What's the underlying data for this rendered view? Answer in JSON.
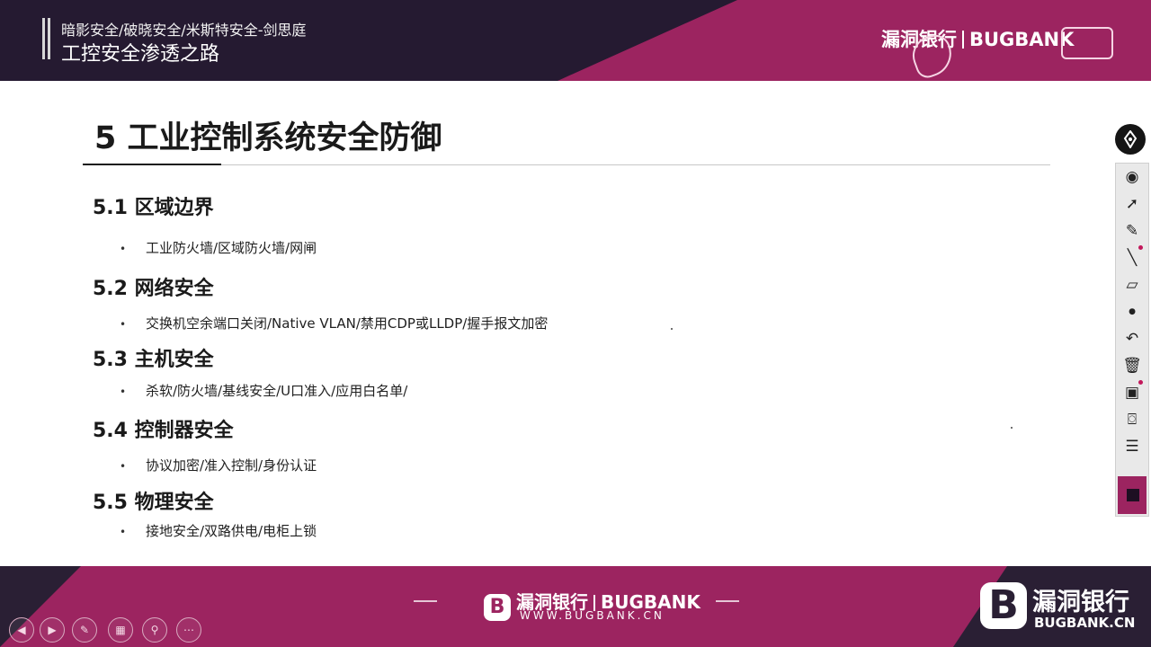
{
  "header": {
    "subtitle": "暗影安全/破晓安全/米斯特安全-剑思庭",
    "title": "工控安全渗透之路",
    "brand_cn": "漏洞银行",
    "brand_en": "BUGBANK"
  },
  "slide": {
    "title": "5 工业控制系统安全防御",
    "sections": [
      {
        "heading": "5.1 区域边界",
        "item": "工业防火墙/区域防火墙/网闸"
      },
      {
        "heading": "5.2 网络安全",
        "item": "交换机空余端口关闭/Native VLAN/禁用CDP或LLDP/握手报文加密"
      },
      {
        "heading": "5.3 主机安全",
        "item": "杀软/防火墙/基线安全/U口准入/应用白名单/"
      },
      {
        "heading": "5.4 控制器安全",
        "item": "协议加密/准入控制/身份认证"
      },
      {
        "heading": "5.5 物理安全",
        "item": "接地安全/双路供电/电柜上锁"
      }
    ],
    "bullet": "•"
  },
  "toolbar": {
    "tools": [
      "pen-icon",
      "eye-icon",
      "pointer-icon",
      "highlighter-icon",
      "line-icon",
      "eraser-icon",
      "dot-icon",
      "undo-icon",
      "trash-icon",
      "whiteboard-icon",
      "camera-icon",
      "clipboard-icon"
    ],
    "accent": "#9c2460"
  },
  "footer": {
    "mid_cn": "漏洞银行",
    "mid_en": "BUGBANK",
    "url": "WWW.BUGBANK.CN",
    "right_cn": "漏洞银行",
    "right_en": "BUGBANK.CN",
    "logo_letter": "B"
  },
  "nav_buttons": [
    "prev-button",
    "next-button",
    "pen-button",
    "pages-button",
    "zoom-button",
    "more-button"
  ],
  "colors": {
    "header_bg": "#251a31",
    "accent": "#9c2460",
    "text": "#1a1a1a"
  }
}
